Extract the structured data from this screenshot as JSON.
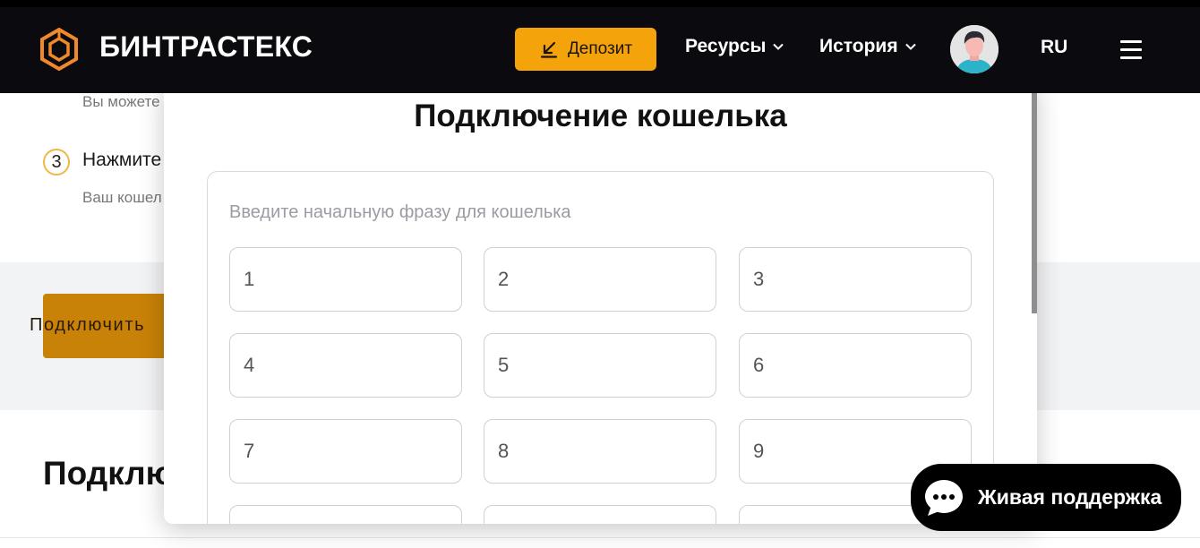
{
  "header": {
    "brand": "БИНТРАСТЕКС",
    "deposit_label": "Депозит",
    "nav": [
      {
        "label": "Ресурсы"
      },
      {
        "label": "История"
      }
    ],
    "language": "RU"
  },
  "background": {
    "step_sub_1": "Вы можете",
    "step_number": "3",
    "step_title": "Нажмите",
    "step_sub_2": "Ваш кошел",
    "connect_button": "Подключить",
    "section_heading": "Подклю"
  },
  "modal": {
    "title": "Подключение кошелька",
    "seed_placeholder": "Введите начальную фразу для кошелька",
    "words": [
      "1",
      "2",
      "3",
      "4",
      "5",
      "6",
      "7",
      "8",
      "9",
      "",
      "",
      ""
    ]
  },
  "support": {
    "label": "Живая поддержка"
  },
  "colors": {
    "header_bg": "#0b0a0f",
    "accent": "#f5a30b",
    "step_circle": "#f0b844",
    "connect_button": "#c98208"
  },
  "icons": {
    "logo": "hexagon-logo-icon",
    "deposit": "download-arrow-icon",
    "dropdown": "chevron-down-icon",
    "menu": "hamburger-menu-icon",
    "support": "chat-bubble-icon"
  }
}
